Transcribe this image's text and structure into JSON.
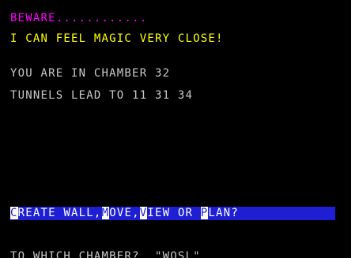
{
  "screen": {
    "line1": "BEWARE............",
    "line2": "I CAN FEEL MAGIC VERY CLOSE!",
    "location": "YOU ARE IN CHAMBER 32",
    "tunnels": "TUNNELS LEAD TO 11 31 34"
  },
  "menu": {
    "create_key": "C",
    "create_rest": "REATE WALL,",
    "move_key": "M",
    "move_rest": "OVE,",
    "view_key": "V",
    "view_rest": "IEW OR ",
    "plan_key": "P",
    "plan_rest": "LAN?"
  },
  "input": {
    "question": "TO WHICH CHAMBER?  \"WOSL\""
  },
  "colors": {
    "warning": "#ff00ff",
    "magic": "#ffff00",
    "status": "#c8c8c8",
    "menu_bar": "#1e1ed2"
  }
}
